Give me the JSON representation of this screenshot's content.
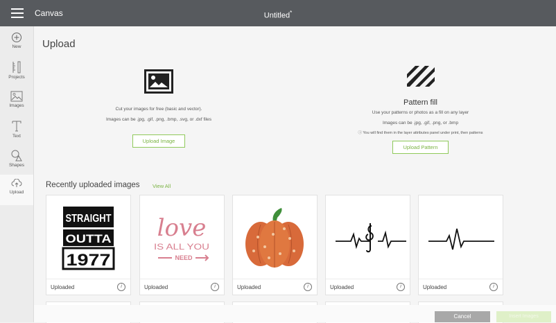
{
  "topbar": {
    "app_name": "Canvas",
    "doc_title": "Untitled",
    "unsaved_mark": "*"
  },
  "sidebar": {
    "items": [
      {
        "label": "New",
        "icon": "plus-circle-icon"
      },
      {
        "label": "Projects",
        "icon": "ruler-icon"
      },
      {
        "label": "Images",
        "icon": "image-icon"
      },
      {
        "label": "Text",
        "icon": "text-icon"
      },
      {
        "label": "Shapes",
        "icon": "shapes-icon"
      },
      {
        "label": "Upload",
        "icon": "upload-icon"
      }
    ]
  },
  "main": {
    "title": "Upload",
    "upload_image": {
      "line1": "Cut your images for free (basic and vector).",
      "line2": "Images can be .jpg, .gif, .png, .bmp, .svg, or .dxf files",
      "button": "Upload Image"
    },
    "pattern_fill": {
      "title": "Pattern fill",
      "line1": "Use your patterns or photos as a fill on any layer",
      "line2": "Images can be .jpg, .gif, .png, or .bmp",
      "note": "You will find them in the layer attributes panel under print, then patterns",
      "button": "Upload Pattern"
    },
    "recent": {
      "title": "Recently uploaded images",
      "view_all": "View All",
      "cards": [
        {
          "label": "Uploaded",
          "art": [
            "STRAIGHT",
            "OUTTA",
            "1977"
          ]
        },
        {
          "label": "Uploaded",
          "art": [
            "love",
            "IS ALL YOU",
            "NEED"
          ]
        },
        {
          "label": "Uploaded",
          "art": []
        },
        {
          "label": "Uploaded",
          "art": []
        },
        {
          "label": "Uploaded",
          "art": []
        }
      ]
    }
  },
  "footer": {
    "cancel": "Cancel",
    "insert": "Insert Images"
  },
  "colors": {
    "topbar": "#575a5e",
    "accent": "#7ab342"
  }
}
